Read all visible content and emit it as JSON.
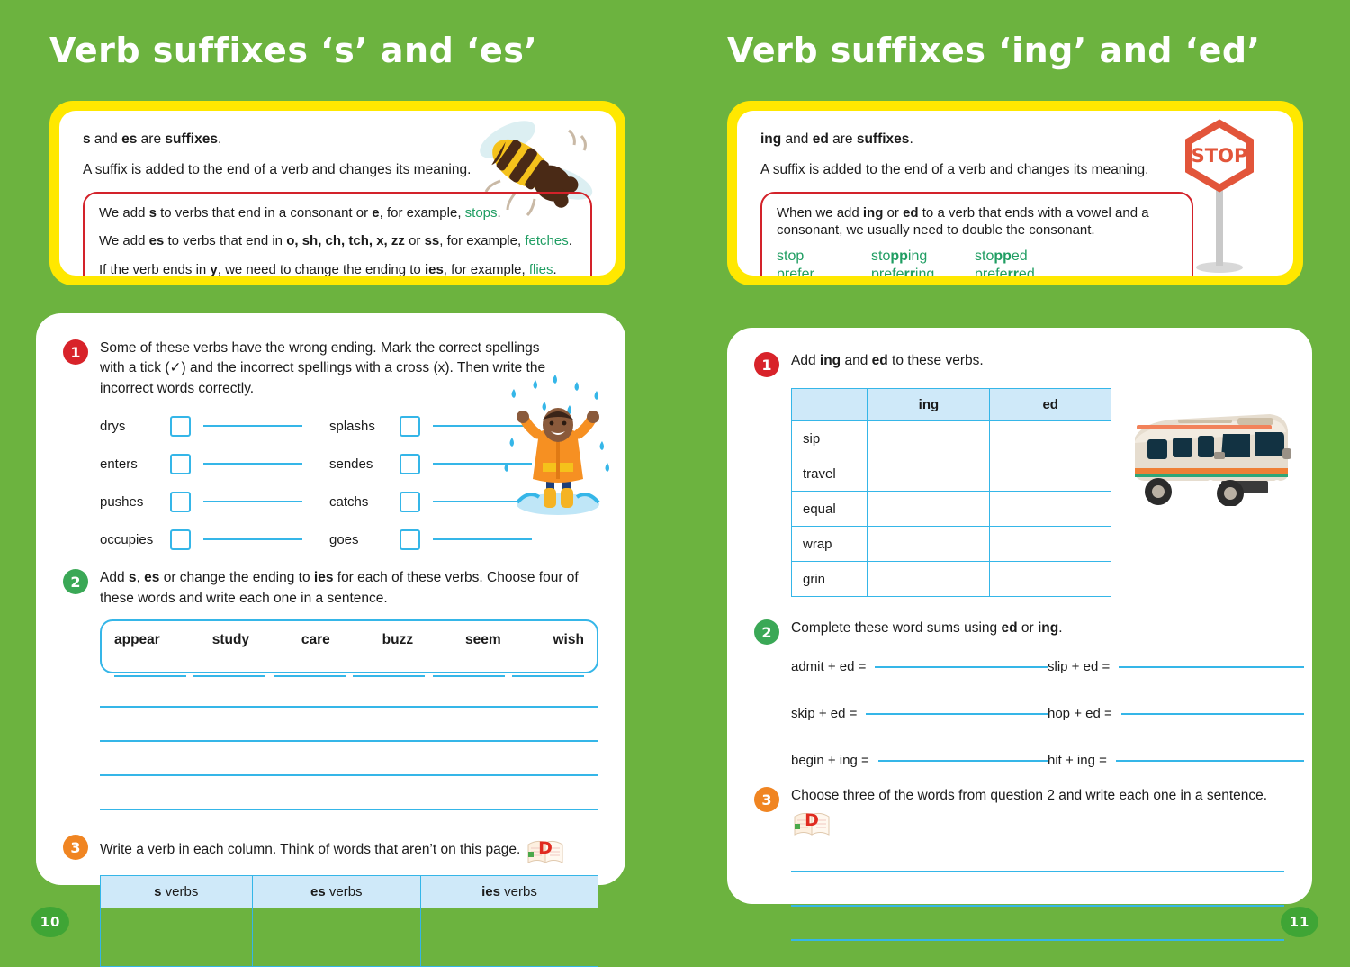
{
  "left_page": {
    "title": "Verb suffixes ‘s’ and ‘es’",
    "page_number": "10",
    "info": {
      "line1_a": "s",
      "line1_b": " and ",
      "line1_c": "es",
      "line1_d": " are ",
      "line1_e": "suffixes",
      "line1_f": ".",
      "line2": "A suffix is added to the end of a verb and changes its meaning.",
      "rules": [
        {
          "pre": "We add ",
          "bold": "s",
          "mid": " to verbs that end in a consonant or ",
          "bold2": "e",
          "mid2": ", for example, ",
          "example": "stops",
          "post": "."
        },
        {
          "pre": "We add ",
          "bold": "es",
          "mid": " to verbs that end in ",
          "bold2": "o, sh, ch, tch, x, zz",
          "mid2": " or ",
          "bold3": "ss",
          "mid3": ", for example, ",
          "example": "fetches",
          "post": "."
        },
        {
          "pre": "If the verb ends in ",
          "bold": "y",
          "mid": ", we need to change the ending to ",
          "bold2": "ies",
          "mid2": ", for example, ",
          "example": "flies",
          "post": "."
        }
      ]
    },
    "q1": {
      "number": "1",
      "text": "Some of these verbs have the wrong ending. Mark the correct spellings with a tick (✓) and the incorrect spellings with a cross (x). Then write the incorrect words correctly.",
      "column_a": [
        "drys",
        "enters",
        "pushes",
        "occupies"
      ],
      "column_b": [
        "splashs",
        "sendes",
        "catchs",
        "goes"
      ]
    },
    "q2": {
      "number": "2",
      "text_a": "Add ",
      "text_b": "s",
      "text_c": ", ",
      "text_d": "es",
      "text_e": " or change the ending to ",
      "text_f": "ies",
      "text_g": " for each of these verbs. Choose four of these words and write each one in a sentence.",
      "words": [
        "appear",
        "study",
        "care",
        "buzz",
        "seem",
        "wish"
      ]
    },
    "q3": {
      "number": "3",
      "text": "Write a verb in each column. Think of words that aren’t on this page.",
      "icon": "dictionary-book-icon",
      "table": {
        "headers": [
          {
            "bold": "s",
            "rest": " verbs"
          },
          {
            "bold": "es",
            "rest": " verbs"
          },
          {
            "bold": "ies",
            "rest": " verbs"
          }
        ],
        "rows": [
          [
            "",
            "",
            ""
          ]
        ]
      }
    },
    "illustrations": [
      "bee-icon",
      "child-in-rain-icon"
    ]
  },
  "right_page": {
    "title": "Verb suffixes ‘ing’ and ‘ed’",
    "page_number": "11",
    "info": {
      "line1_a": "ing",
      "line1_b": " and ",
      "line1_c": "ed",
      "line1_d": " are ",
      "line1_e": "suffixes",
      "line1_f": ".",
      "line2": "A suffix is added to the end of a verb and changes its meaning.",
      "rule_a": "When we add ",
      "rule_b": "ing",
      "rule_c": " or ",
      "rule_d": "ed",
      "rule_e": " to a verb that ends with a vowel and a consonant, we usually need to double the consonant.",
      "examples": [
        {
          "base": "stop",
          "ing_pre": "sto",
          "ing_bold": "pp",
          "ing_post": "ing",
          "ed_pre": "sto",
          "ed_bold": "pp",
          "ed_post": "ed"
        },
        {
          "base": "prefer",
          "ing_pre": "prefe",
          "ing_bold": "rr",
          "ing_post": "ing",
          "ed_pre": "prefe",
          "ed_bold": "rr",
          "ed_post": "ed"
        }
      ],
      "stop_sign_label": "STOP"
    },
    "q1": {
      "number": "1",
      "text_a": "Add ",
      "text_b": "ing",
      "text_c": " and ",
      "text_d": "ed",
      "text_e": " to these verbs.",
      "table": {
        "headers": [
          "",
          "ing",
          "ed"
        ],
        "rows": [
          [
            "sip",
            "",
            ""
          ],
          [
            "travel",
            "",
            ""
          ],
          [
            "equal",
            "",
            ""
          ],
          [
            "wrap",
            "",
            ""
          ],
          [
            "grin",
            "",
            ""
          ]
        ]
      }
    },
    "q2": {
      "number": "2",
      "text_a": "Complete these word sums using ",
      "text_b": "ed",
      "text_c": " or ",
      "text_d": "ing",
      "text_e": ".",
      "sums": [
        "admit + ed =",
        "slip + ed =",
        "skip + ed =",
        "hop + ed =",
        "begin + ing =",
        "hit + ing ="
      ]
    },
    "q3": {
      "number": "3",
      "text": "Choose three of the words from question 2 and write each one in a sentence.",
      "icon": "dictionary-book-icon"
    },
    "illustrations": [
      "stop-sign-icon",
      "camper-van-icon"
    ]
  },
  "colors": {
    "background_green": "#6cb33f",
    "card_white": "#ffffff",
    "info_yellow": "#ffe800",
    "rule_border_red": "#d3222a",
    "example_green": "#1f9d62",
    "line_blue": "#35b6e8",
    "table_header_blue": "#cfe9f9",
    "badge_red": "#d8232a",
    "badge_green": "#3aa856",
    "badge_orange": "#f08522",
    "page_number_green": "#3fa535"
  }
}
